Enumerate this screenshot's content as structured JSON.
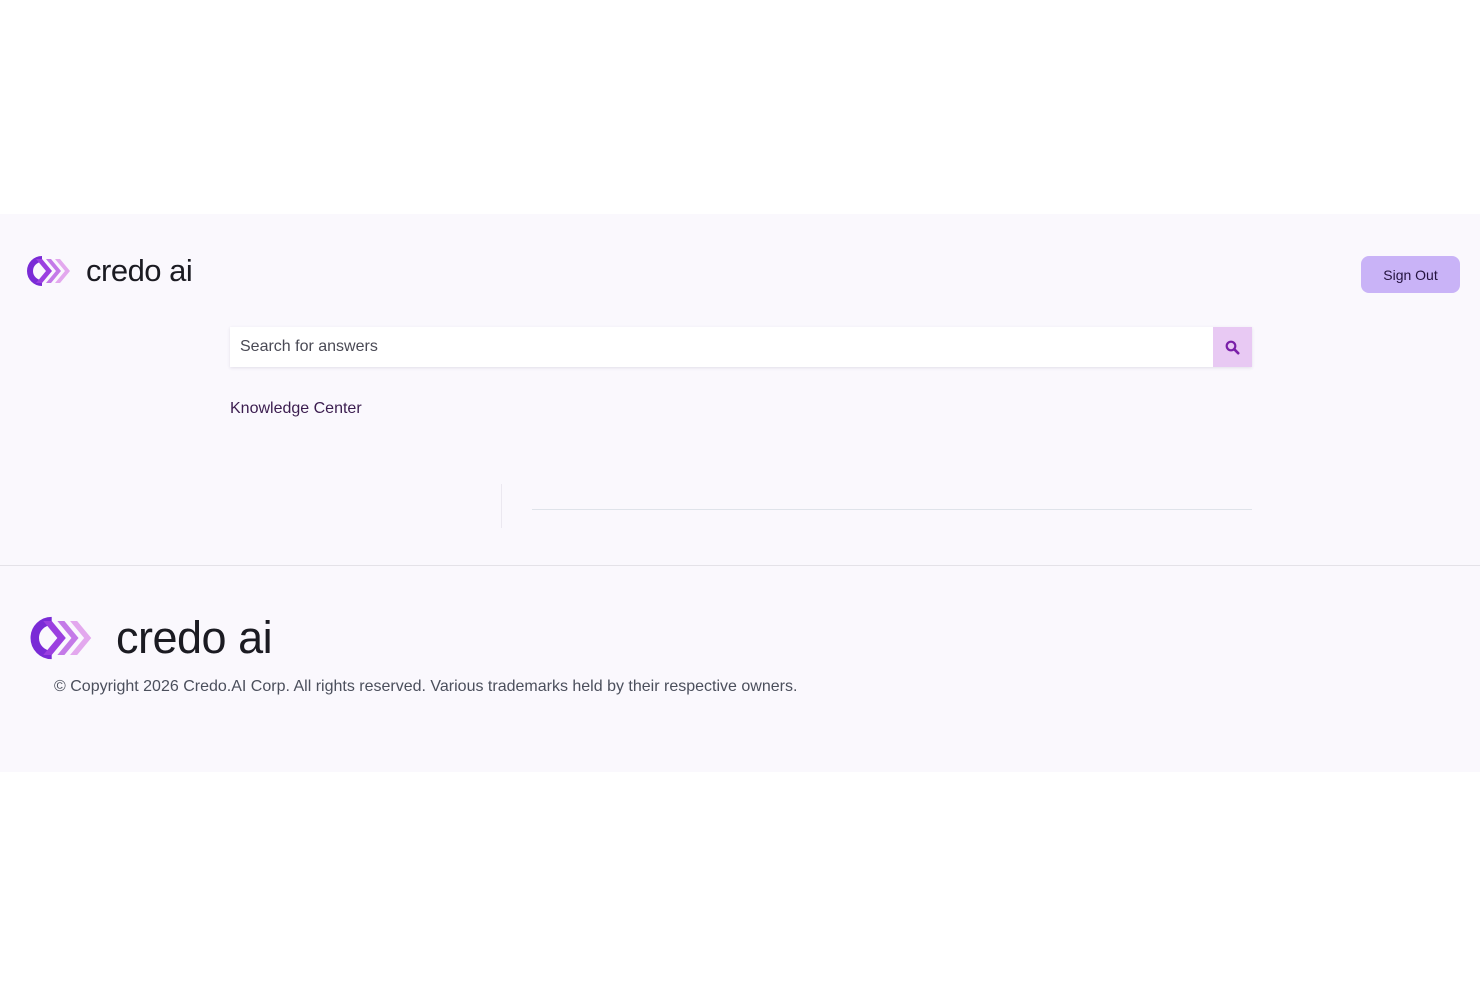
{
  "header": {
    "brand": "credo ai",
    "sign_out_label": "Sign Out"
  },
  "search": {
    "placeholder": "Search for answers",
    "value": "",
    "button_icon": "search-icon"
  },
  "nav": {
    "knowledge_center": "Knowledge Center"
  },
  "footer": {
    "brand": "credo ai",
    "copyright": "© Copyright 2026 Credo.AI Corp. All rights reserved. Various trademarks held by their respective owners."
  },
  "colors": {
    "accent": "#c9b3f7",
    "search_button": "#e8c9f3",
    "band_background": "#faf8fd",
    "logo_purple": "#7a2bd6",
    "logo_pink": "#d98be6"
  }
}
